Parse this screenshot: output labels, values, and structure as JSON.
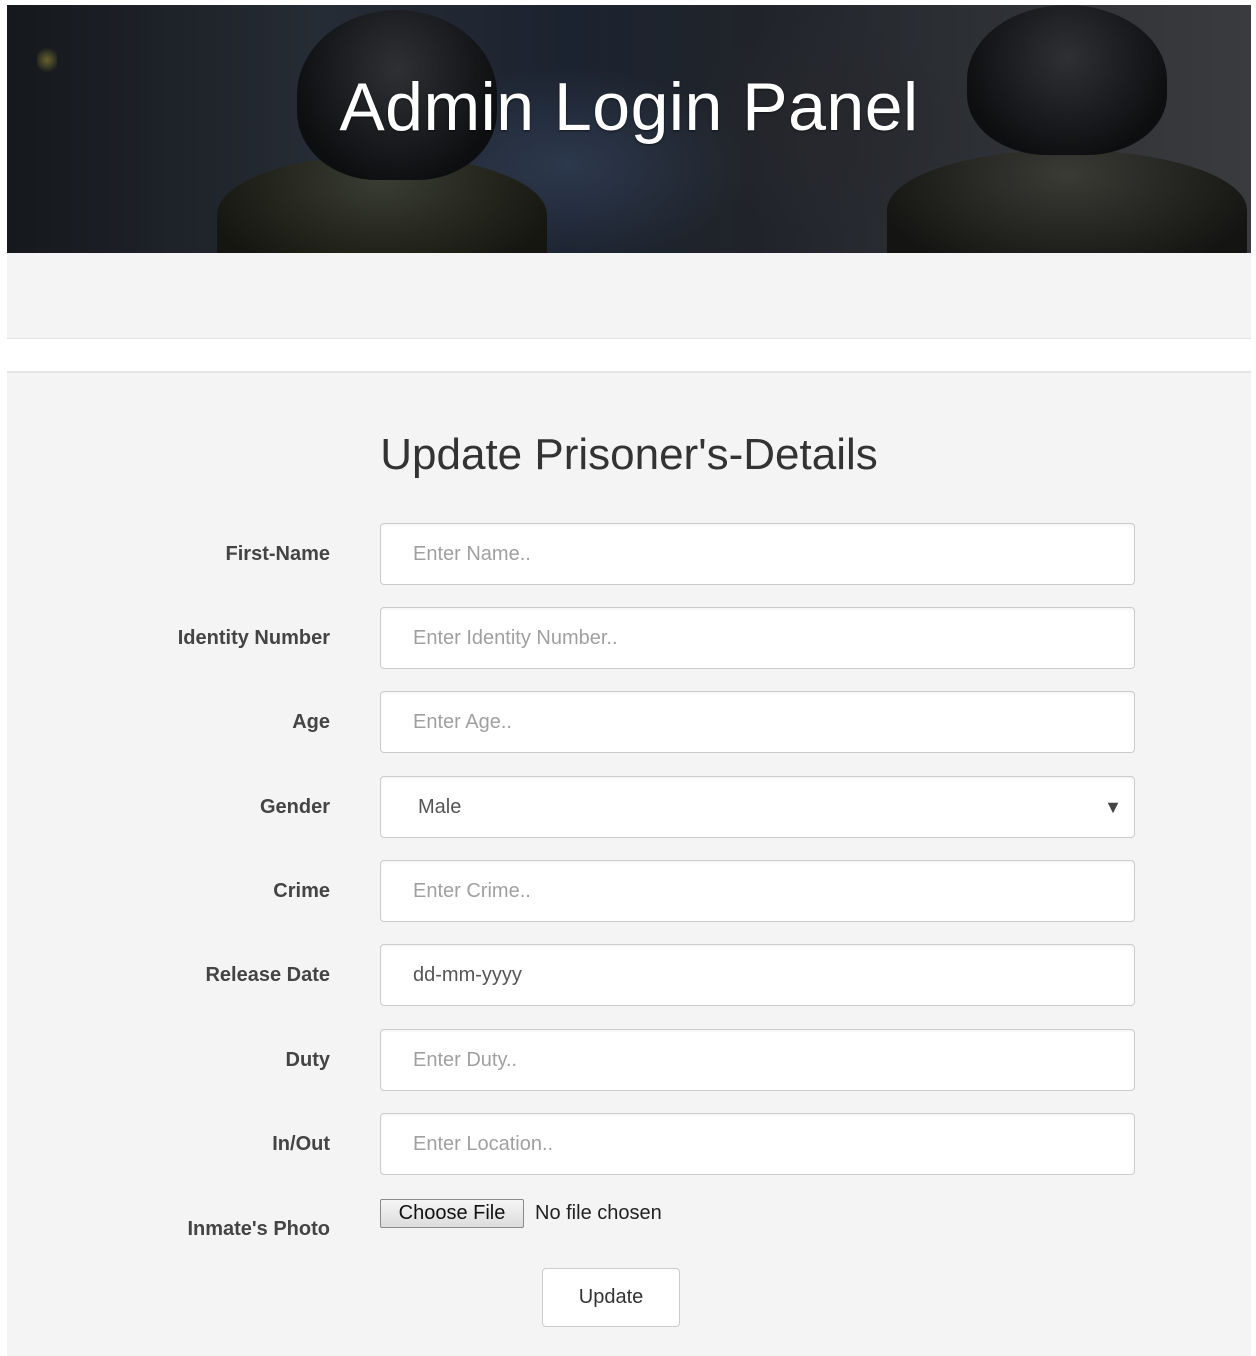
{
  "header": {
    "title": "Admin Login Panel"
  },
  "form": {
    "title": "Update Prisoner's-Details",
    "fields": [
      {
        "label": "First-Name",
        "placeholder": "Enter Name.."
      },
      {
        "label": "Identity Number",
        "placeholder": "Enter Identity Number.."
      },
      {
        "label": "Age",
        "placeholder": "Enter Age.."
      },
      {
        "label": "Gender",
        "value": "Male"
      },
      {
        "label": "Crime",
        "placeholder": "Enter Crime.."
      },
      {
        "label": "Release Date",
        "value": "dd-mm-yyyy"
      },
      {
        "label": "Duty",
        "placeholder": "Enter Duty.."
      },
      {
        "label": "In/Out",
        "placeholder": "Enter Location.."
      }
    ],
    "photo": {
      "label": "Inmate's Photo",
      "button_label": "Choose File",
      "status": "No file chosen"
    },
    "submit_label": "Update"
  }
}
